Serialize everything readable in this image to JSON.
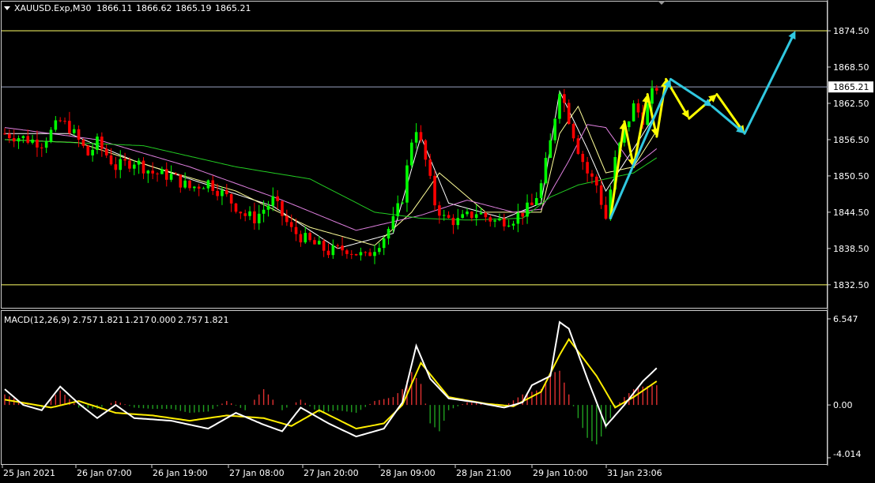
{
  "window": {
    "symbol_label": "XAUUSD.Exp,M30",
    "ohlc": {
      "open": "1866.11",
      "high": "1866.62",
      "low": "1865.19",
      "close": "1865.21"
    }
  },
  "colors": {
    "background": "#000000",
    "frame": "#ffffff",
    "bull_candle": "#00ff00",
    "bear_candle": "#ff0000",
    "level_line": "#ffff66",
    "current_price_line": "#9aa3c0",
    "ma_white": "#ffffff",
    "ma_yellow": "#ffff99",
    "ma_violet": "#e080e0",
    "ma_green": "#22cc22",
    "macd_main": "#ffffff",
    "macd_signal": "#ffee00",
    "hist_pos": "#e03030",
    "hist_neg": "#20a020",
    "arrow_yellow": "#ffff00",
    "arrow_cyan": "#30c8e0"
  },
  "chart_data": [
    {
      "type": "candlestick",
      "name": "price",
      "ylim": [
        1830.0,
        1877.5
      ],
      "y_ticks": [
        "1874.50",
        "1868.50",
        "1862.50",
        "1856.50",
        "1850.50",
        "1844.50",
        "1838.50",
        "1832.50"
      ],
      "current_price": "1865.21",
      "horizontal_levels": [
        1874.5,
        1832.5
      ],
      "x_tick_labels": [
        "25 Jan 2021",
        "26 Jan 07:00",
        "26 Jan 19:00",
        "27 Jan 08:00",
        "27 Jan 20:00",
        "28 Jan 09:00",
        "28 Jan 21:00",
        "29 Jan 10:00",
        "31 Jan 23:06"
      ],
      "price_path": [
        [
          0,
          1857.5
        ],
        [
          8,
          1856.0
        ],
        [
          12,
          1859.5
        ],
        [
          14,
          1858.5
        ],
        [
          18,
          1854.0
        ],
        [
          20,
          1856.0
        ],
        [
          24,
          1852.0
        ],
        [
          28,
          1853.0
        ],
        [
          32,
          1851.0
        ],
        [
          36,
          1850.5
        ],
        [
          40,
          1848.5
        ],
        [
          44,
          1849.5
        ],
        [
          48,
          1847.0
        ],
        [
          52,
          1844.0
        ],
        [
          54,
          1843.5
        ],
        [
          58,
          1846.5
        ],
        [
          62,
          1841.5
        ],
        [
          66,
          1839.5
        ],
        [
          70,
          1838.0
        ],
        [
          74,
          1838.5
        ],
        [
          78,
          1837.0
        ],
        [
          82,
          1840.5
        ],
        [
          84,
          1843.0
        ],
        [
          86,
          1847.0
        ],
        [
          88,
          1856.5
        ],
        [
          89,
          1858.5
        ],
        [
          91,
          1853.0
        ],
        [
          93,
          1846.0
        ],
        [
          95,
          1843.5
        ],
        [
          98,
          1843.0
        ],
        [
          102,
          1844.5
        ],
        [
          106,
          1843.0
        ],
        [
          110,
          1843.5
        ],
        [
          114,
          1845.5
        ],
        [
          116,
          1849.0
        ],
        [
          118,
          1856.0
        ],
        [
          120,
          1865.0
        ],
        [
          122,
          1860.0
        ],
        [
          124,
          1855.0
        ],
        [
          126,
          1851.0
        ],
        [
          128,
          1849.0
        ],
        [
          130,
          1843.5
        ],
        [
          132,
          1853.0
        ],
        [
          134,
          1858.0
        ],
        [
          136,
          1862.0
        ],
        [
          138,
          1860.0
        ],
        [
          140,
          1864.0
        ],
        [
          141,
          1865.2
        ]
      ],
      "moving_averages": [
        {
          "name": "MA fast",
          "color_key": "ma_white",
          "points": [
            [
              0,
              1857.5
            ],
            [
              14,
              1857.5
            ],
            [
              28,
              1853
            ],
            [
              44,
              1849
            ],
            [
              58,
              1845.5
            ],
            [
              72,
              1838.5
            ],
            [
              84,
              1841
            ],
            [
              90,
              1857
            ],
            [
              96,
              1846
            ],
            [
              108,
              1843.5
            ],
            [
              116,
              1846
            ],
            [
              120,
              1864.5
            ],
            [
              126,
              1855
            ],
            [
              130,
              1848
            ],
            [
              136,
              1855
            ],
            [
              141,
              1861
            ]
          ]
        },
        {
          "name": "MA medium",
          "color_key": "ma_yellow",
          "points": [
            [
              0,
              1856.5
            ],
            [
              16,
              1856
            ],
            [
              32,
              1852
            ],
            [
              50,
              1848
            ],
            [
              66,
              1842
            ],
            [
              80,
              1839
            ],
            [
              88,
              1844.5
            ],
            [
              94,
              1851
            ],
            [
              104,
              1844.5
            ],
            [
              116,
              1844.5
            ],
            [
              120,
              1857.5
            ],
            [
              124,
              1862
            ],
            [
              130,
              1851
            ],
            [
              136,
              1852
            ],
            [
              141,
              1858
            ]
          ]
        },
        {
          "name": "MA slow",
          "color_key": "ma_violet",
          "points": [
            [
              0,
              1858.5
            ],
            [
              20,
              1856.5
            ],
            [
              40,
              1852
            ],
            [
              60,
              1846.5
            ],
            [
              76,
              1841.5
            ],
            [
              90,
              1844
            ],
            [
              100,
              1846.5
            ],
            [
              110,
              1844.5
            ],
            [
              116,
              1845
            ],
            [
              122,
              1853
            ],
            [
              126,
              1859
            ],
            [
              130,
              1858.5
            ],
            [
              136,
              1852
            ],
            [
              141,
              1855
            ]
          ]
        },
        {
          "name": "MA long",
          "color_key": "ma_green",
          "points": [
            [
              0,
              1856.5
            ],
            [
              30,
              1855.5
            ],
            [
              50,
              1852
            ],
            [
              66,
              1850
            ],
            [
              80,
              1844.5
            ],
            [
              90,
              1843.5
            ],
            [
              100,
              1843.2
            ],
            [
              112,
              1843.5
            ],
            [
              118,
              1847
            ],
            [
              124,
              1849
            ],
            [
              130,
              1850
            ],
            [
              136,
              1851
            ],
            [
              141,
              1853.5
            ]
          ]
        }
      ],
      "forecast_arrows": [
        {
          "color_key": "arrow_yellow",
          "path": [
            [
              131,
              1843.5
            ],
            [
              134,
              1859.5
            ],
            [
              136,
              1852
            ],
            [
              139,
              1864
            ],
            [
              141,
              1857
            ],
            [
              143,
              1866.5
            ],
            [
              148,
              1860
            ],
            [
              154,
              1864
            ],
            [
              160,
              1857.5
            ]
          ]
        },
        {
          "color_key": "arrow_cyan",
          "path": [
            [
              131,
              1843.5
            ],
            [
              144,
              1866.5
            ],
            [
              153,
              1862
            ],
            [
              160,
              1857.5
            ],
            [
              171,
              1874.5
            ]
          ]
        }
      ]
    },
    {
      "type": "macd",
      "name": "MACD(12,26,9)",
      "header_values": [
        "2.757",
        "1.821",
        "1.217",
        "0.000",
        "2.757",
        "1.821"
      ],
      "ylim": [
        -4.014,
        6.547
      ],
      "y_ticks": [
        "6.547",
        "0.00",
        "-4.014"
      ],
      "main_line": [
        [
          0,
          1.2
        ],
        [
          4,
          0
        ],
        [
          8,
          -0.4
        ],
        [
          12,
          1.4
        ],
        [
          16,
          0.1
        ],
        [
          20,
          -1.0
        ],
        [
          24,
          0
        ],
        [
          28,
          -1.0
        ],
        [
          36,
          -1.2
        ],
        [
          44,
          -1.8
        ],
        [
          50,
          -0.6
        ],
        [
          56,
          -1.5
        ],
        [
          60,
          -2.0
        ],
        [
          64,
          -0.2
        ],
        [
          70,
          -1.4
        ],
        [
          76,
          -2.4
        ],
        [
          82,
          -1.8
        ],
        [
          86,
          0.2
        ],
        [
          89,
          4.5
        ],
        [
          92,
          2.0
        ],
        [
          96,
          0.5
        ],
        [
          102,
          0.2
        ],
        [
          108,
          -0.2
        ],
        [
          112,
          0.2
        ],
        [
          114,
          1.5
        ],
        [
          118,
          2.2
        ],
        [
          120,
          6.3
        ],
        [
          122,
          5.8
        ],
        [
          126,
          2.0
        ],
        [
          130,
          -1.6
        ],
        [
          134,
          0
        ],
        [
          138,
          1.8
        ],
        [
          141,
          2.8
        ]
      ],
      "signal_line": [
        [
          0,
          0.4
        ],
        [
          10,
          -0.2
        ],
        [
          16,
          0.3
        ],
        [
          24,
          -0.6
        ],
        [
          32,
          -0.8
        ],
        [
          40,
          -1.2
        ],
        [
          48,
          -0.8
        ],
        [
          56,
          -1.0
        ],
        [
          62,
          -1.6
        ],
        [
          68,
          -0.4
        ],
        [
          76,
          -1.8
        ],
        [
          82,
          -1.4
        ],
        [
          86,
          0
        ],
        [
          90,
          3.2
        ],
        [
          96,
          0.6
        ],
        [
          104,
          0.1
        ],
        [
          110,
          -0.1
        ],
        [
          116,
          1.0
        ],
        [
          120,
          3.8
        ],
        [
          122,
          5.0
        ],
        [
          128,
          2.2
        ],
        [
          132,
          -0.2
        ],
        [
          136,
          0.6
        ],
        [
          141,
          1.8
        ]
      ],
      "histogram": [
        [
          0,
          0.8
        ],
        [
          4,
          0.2
        ],
        [
          8,
          -0.2
        ],
        [
          12,
          1.1
        ],
        [
          16,
          -0.2
        ],
        [
          20,
          -0.3
        ],
        [
          24,
          0.3
        ],
        [
          28,
          -0.2
        ],
        [
          32,
          -0.3
        ],
        [
          36,
          -0.3
        ],
        [
          40,
          -0.6
        ],
        [
          44,
          -0.5
        ],
        [
          48,
          0.3
        ],
        [
          52,
          -0.4
        ],
        [
          56,
          1.2
        ],
        [
          60,
          -0.4
        ],
        [
          64,
          0.4
        ],
        [
          68,
          -0.6
        ],
        [
          72,
          -0.4
        ],
        [
          76,
          -0.6
        ],
        [
          80,
          0.3
        ],
        [
          84,
          0.6
        ],
        [
          86,
          1.2
        ],
        [
          88,
          2.5
        ],
        [
          90,
          1.6
        ],
        [
          92,
          -1.4
        ],
        [
          94,
          -2.0
        ],
        [
          96,
          -0.4
        ],
        [
          100,
          0.2
        ],
        [
          104,
          0.1
        ],
        [
          108,
          -0.1
        ],
        [
          112,
          0.8
        ],
        [
          116,
          1.2
        ],
        [
          118,
          2.4
        ],
        [
          120,
          2.6
        ],
        [
          122,
          0.8
        ],
        [
          124,
          -1.0
        ],
        [
          126,
          -2.5
        ],
        [
          128,
          -3.0
        ],
        [
          130,
          -1.8
        ],
        [
          132,
          -0.2
        ],
        [
          134,
          0.6
        ],
        [
          136,
          1.2
        ],
        [
          138,
          1.4
        ],
        [
          141,
          1.5
        ]
      ]
    }
  ]
}
